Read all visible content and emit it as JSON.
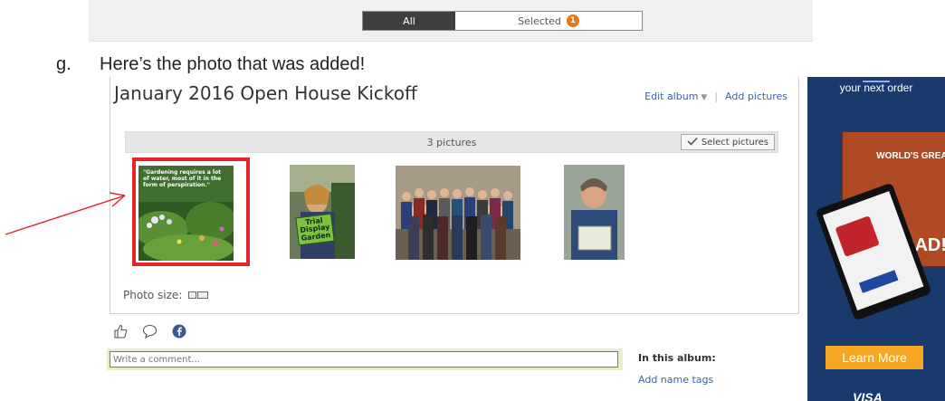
{
  "toggle": {
    "all_label": "All",
    "selected_label": "Selected",
    "selected_count": "1"
  },
  "step": {
    "letter": "g.",
    "text": "Here’s the photo that was added!"
  },
  "album": {
    "title": "January 2016 Open House Kickoff",
    "edit_label": "Edit album",
    "separator": "|",
    "add_pictures_label": "Add pictures",
    "picture_count": "3 pictures",
    "select_pictures_label": "Select pictures",
    "photo_size_label": "Photo size:",
    "photos": [
      {
        "name": "gardening-quote",
        "quote_text": "\"Gardening requires a lot of water, most of it in the form of perspiration.\""
      },
      {
        "name": "trial-display-garden",
        "sign_text": "Trial Display Garden"
      },
      {
        "name": "group-photo"
      },
      {
        "name": "certificate-photo"
      }
    ]
  },
  "social": {
    "icons": [
      "thumbs-up-icon",
      "comment-icon",
      "facebook-icon"
    ]
  },
  "comment": {
    "placeholder": "Write a comment..."
  },
  "sidebar_info": {
    "in_album_label": "In this album:",
    "name_tags_label": "Add name tags"
  },
  "ad": {
    "headline": "your next order",
    "book_title": "WORLD'S GREAT",
    "dad_text": "DAD!",
    "button_label": "Learn More",
    "brand": "VISA"
  },
  "colors": {
    "link": "#3b63a8",
    "highlight": "#e3242b",
    "ad_background": "#1a3a6e",
    "ad_button": "#f5a623",
    "badge": "#e8751a"
  }
}
